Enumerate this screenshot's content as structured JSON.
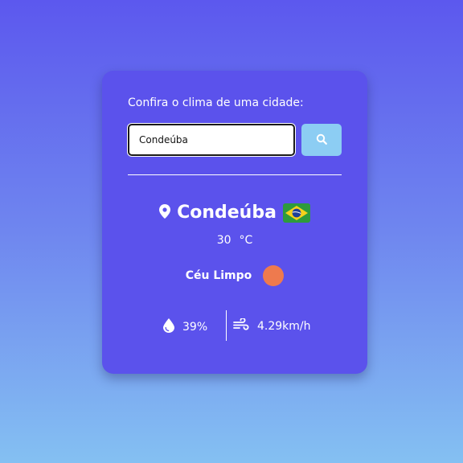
{
  "search": {
    "prompt": "Confira o clima de uma cidade:",
    "value": "Condeúba",
    "button_icon": "search-icon"
  },
  "weather": {
    "location_icon": "map-marker-icon",
    "city": "Condeúba",
    "country_flag": "brazil-flag",
    "temperature": "30",
    "unit": "°C",
    "description": "Céu Limpo",
    "weather_icon": "weather-condition-icon",
    "humidity_icon": "water-drop-icon",
    "humidity": "39%",
    "wind_icon": "wind-icon",
    "wind": "4.29km/h"
  },
  "colors": {
    "card": "#5b52ec",
    "search_button": "#8ccdf3",
    "weather_dot": "#ee7a4e"
  }
}
